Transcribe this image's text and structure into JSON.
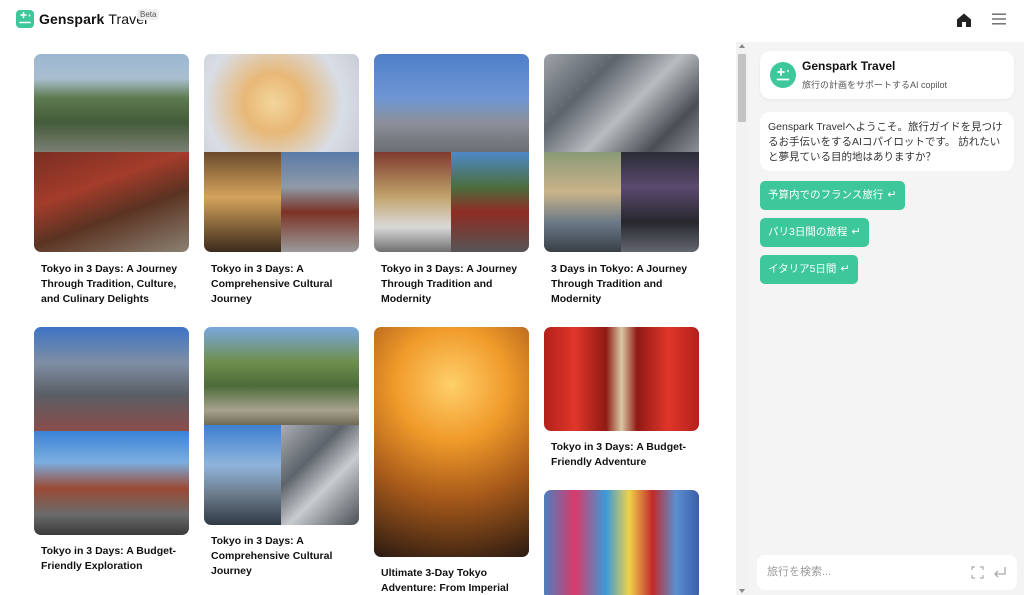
{
  "header": {
    "brand": "Genspark",
    "brand_suffix": "Travel",
    "badge": "Beta",
    "icons": [
      "logo-icon",
      "home-icon",
      "menu-icon"
    ]
  },
  "feed": {
    "cards": [
      {
        "title": "Tokyo in 3 Days: A Journey Through Tradition, Culture, and Culinary Delights"
      },
      {
        "title": "Tokyo in 3 Days: A Comprehensive Cultural Journey"
      },
      {
        "title": "Tokyo in 3 Days: A Journey Through Tradition and Modernity"
      },
      {
        "title": "3 Days in Tokyo: A Journey Through Tradition and Modernity"
      },
      {
        "title": "Tokyo in 3 Days: A Budget-Friendly Exploration"
      },
      {
        "title": "Tokyo in 3 Days: A Comprehensive Cultural Journey"
      },
      {
        "title": "Ultimate 3-Day Tokyo Adventure: From Imperial"
      },
      {
        "title": "Tokyo in 3 Days: A Budget-Friendly Adventure"
      },
      {
        "title": ""
      }
    ]
  },
  "chat": {
    "assistant": {
      "name": "Genspark Travel",
      "subtitle": "旅行の計画をサポートするAI copilot"
    },
    "welcome": "Genspark Travelへようこそ。旅行ガイドを見つけるお手伝いをするAIコパイロットです。 訪れたいと夢見ている目的地はありますか？",
    "suggestions": [
      {
        "label": "予算内でのフランス旅行"
      },
      {
        "label": "パリ3日間の旅程"
      },
      {
        "label": "イタリア5日間"
      }
    ],
    "return_glyph": "↵",
    "search": {
      "placeholder": "旅行を検索..."
    }
  },
  "colors": {
    "accent": "#3ec79a",
    "panel_bg": "#f4f4f4"
  }
}
